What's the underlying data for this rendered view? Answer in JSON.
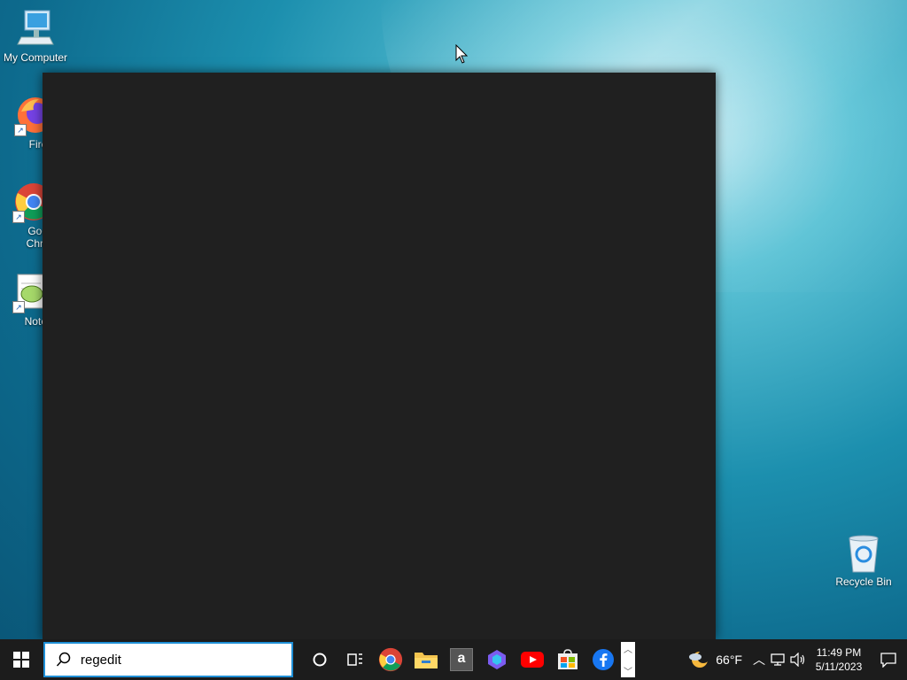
{
  "desktop": {
    "icons": [
      {
        "label": "My Computer",
        "icon": "computer-icon"
      },
      {
        "label": "Firefo",
        "icon": "firefox-icon"
      },
      {
        "label": "Goog\nChron",
        "icon": "chrome-icon"
      },
      {
        "label": "Notepa",
        "icon": "notepad-plus-icon"
      },
      {
        "label": "Recycle Bin",
        "icon": "recycle-bin-icon"
      }
    ]
  },
  "taskbar": {
    "search_value": "regedit",
    "pinned": [
      "cortana-icon",
      "task-view-icon",
      "chrome-icon",
      "file-explorer-icon",
      "amazon-icon",
      "copilot-icon",
      "youtube-icon",
      "store-icon",
      "facebook-icon"
    ],
    "weather": {
      "temp": "66°F",
      "icon": "weather-partly-cloudy-night-icon"
    },
    "clock": {
      "time": "11:49 PM",
      "date": "5/11/2023"
    }
  },
  "colors": {
    "taskbar_bg": "#1c1c1c",
    "window_bg": "#202020",
    "search_border": "#1f8fd6",
    "accent": "#0078d7"
  }
}
